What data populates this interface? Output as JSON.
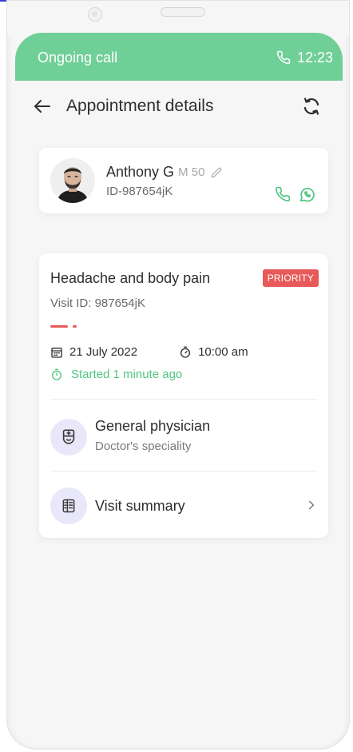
{
  "call_bar": {
    "title": "Ongoing call",
    "time": "12:23",
    "icon": "phone-icon",
    "color": "#6fcf97"
  },
  "header": {
    "title": "Appointment details",
    "back_icon": "arrow-left-icon",
    "refresh_icon": "refresh-icon"
  },
  "patient": {
    "name": "Anthony G",
    "meta": "M 50",
    "id": "ID-987654jK",
    "actions": [
      "phone-icon",
      "whatsapp-icon"
    ]
  },
  "appointment": {
    "condition": "Headache and body pain",
    "badge": "PRIORITY",
    "badge_color": "#e85a5a",
    "visit_id": "Visit ID: 987654jK",
    "date": "21 July 2022",
    "time": "10:00 am",
    "started": "Started 1 minute ago",
    "accent_green": "#4fc77f"
  },
  "specialty": {
    "title": "General physician",
    "subtitle": "Doctor's speciality",
    "icon": "doctor-icon"
  },
  "summary": {
    "title": "Visit summary",
    "icon": "document-icon"
  }
}
